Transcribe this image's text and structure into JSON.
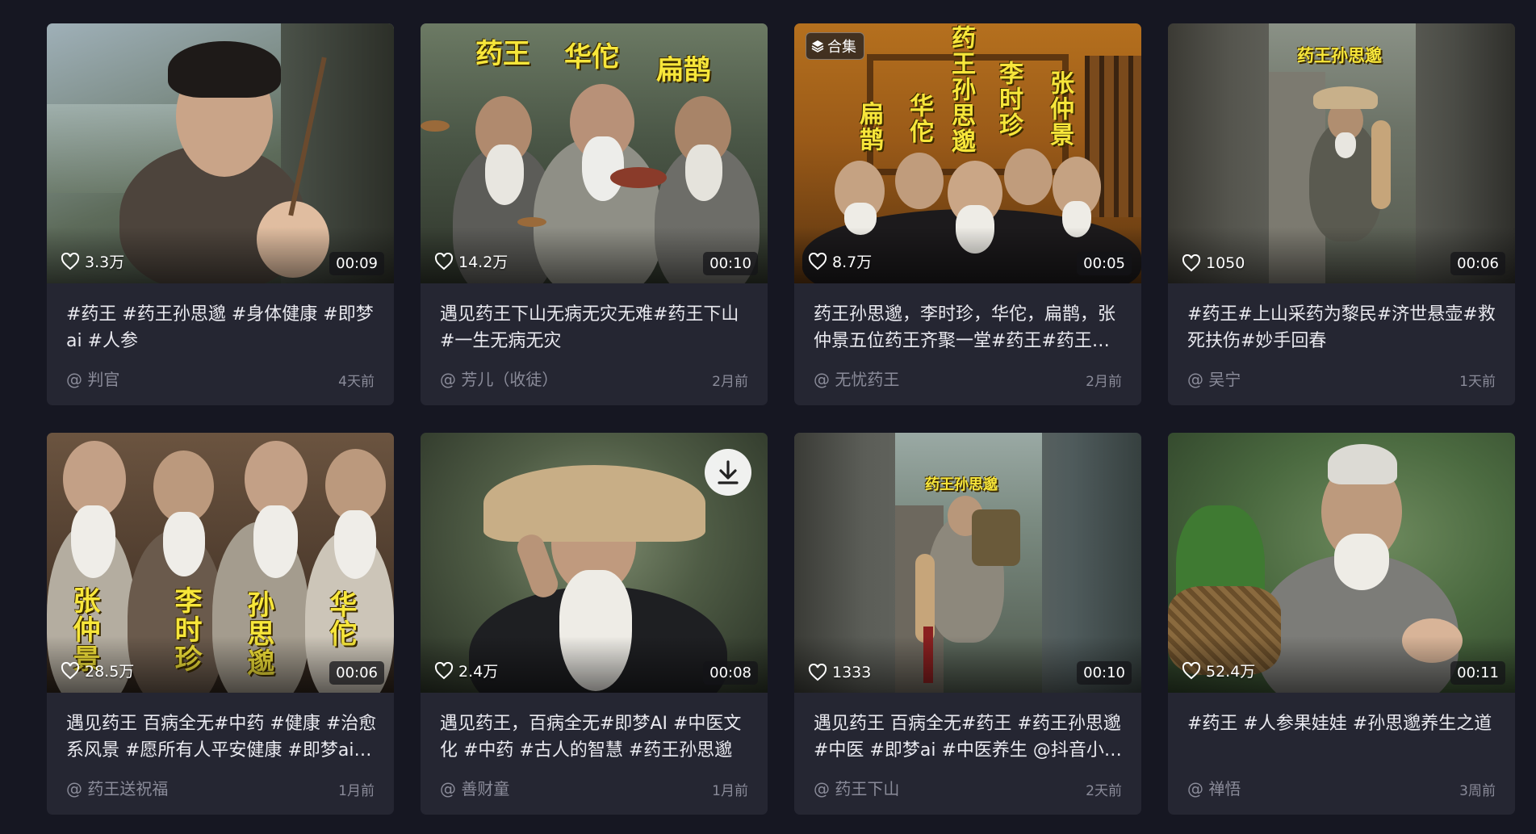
{
  "videos": [
    {
      "likes": "3.3万",
      "duration": "00:09",
      "description": "#药王 #药王孙思邈 #身体健康 #即梦ai #人参",
      "author": "@ 判官",
      "time": "4天前"
    },
    {
      "likes": "14.2万",
      "duration": "00:10",
      "description": "遇见药王下山无病无灾无难#药王下山 #一生无病无灾",
      "author": "@ 芳儿（收徒）",
      "time": "2月前",
      "overlay_titles": [
        "药王",
        "华佗",
        "扁鹊"
      ]
    },
    {
      "likes": "8.7万",
      "duration": "00:05",
      "description": "药王孙思邈，李时珍，华佗，扁鹊，张仲景五位药王齐聚一堂#药王#药王孙思邈",
      "author": "@ 无忧药王",
      "time": "2月前",
      "collection_label": "合集",
      "overlay_titles": [
        "扁鹊",
        "华佗",
        "药王孙思邈",
        "李时珍",
        "张仲景"
      ]
    },
    {
      "likes": "1050",
      "duration": "00:06",
      "description": "#药王#上山采药为黎民#济世悬壶#救死扶伤#妙手回春",
      "author": "@ 吴宁",
      "time": "1天前",
      "overlay_titles": [
        "药王孙思邈"
      ]
    },
    {
      "likes": "28.5万",
      "duration": "00:06",
      "description": "遇见药王 百病全无#中药 #健康 #治愈系风景 #愿所有人平安健康 #即梦ai #药王",
      "author": "@ 药王送祝福",
      "time": "1月前",
      "overlay_titles": [
        "张仲景",
        "李时珍",
        "孙思邈",
        "华佗"
      ]
    },
    {
      "likes": "2.4万",
      "duration": "00:08",
      "description": "遇见药王，百病全无#即梦AI #中医文化 #中药 #古人的智慧 #药王孙思邈",
      "author": "@ 善财童",
      "time": "1月前"
    },
    {
      "likes": "1333",
      "duration": "00:10",
      "description": "遇见药王 百病全无#药王 #药王孙思邈 #中医 #即梦ai #中医养生 @抖音小助手",
      "author": "@ 药王下山",
      "time": "2天前",
      "overlay_titles": [
        "药王孙思邈"
      ]
    },
    {
      "likes": "52.4万",
      "duration": "00:11",
      "description": "#药王 #人参果娃娃 #孙思邈养生之道",
      "author": "@ 禅悟",
      "time": "3周前"
    }
  ],
  "icons": {
    "like": "heart-outline-icon",
    "collection": "layers-icon",
    "download": "download-arrow-icon"
  },
  "colors": {
    "page_bg": "#161722",
    "card_bg": "#252632",
    "meta_text": "#8a8b99",
    "overlay_title": "#f7e63a"
  }
}
